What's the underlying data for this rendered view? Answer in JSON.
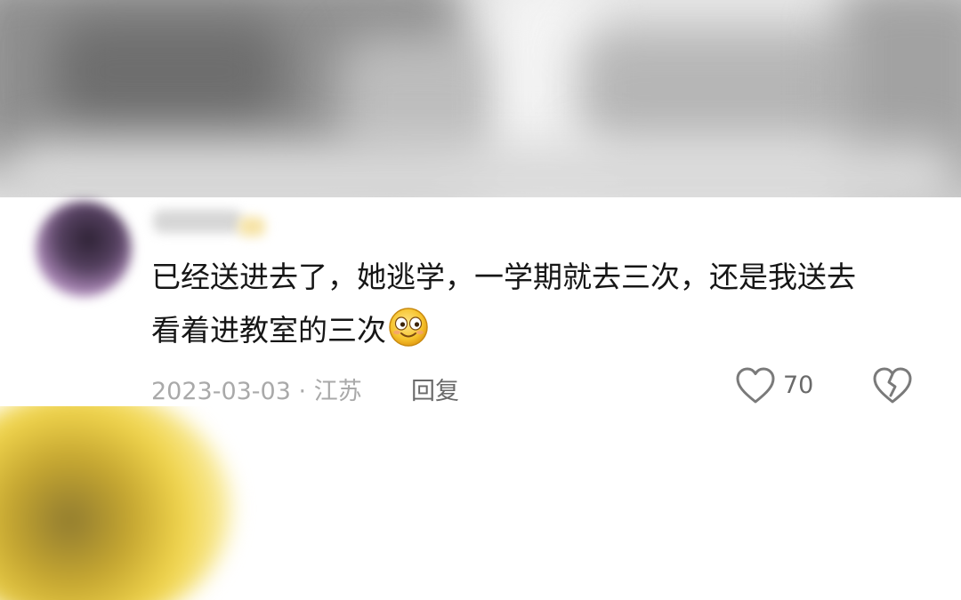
{
  "comment": {
    "text_line1": "已经送进去了，她逃学，一学期就去三次，还是我送去",
    "text_line2": "看着进教室的三次",
    "emoji": "face-emoji",
    "date": "2023-03-03",
    "separator": "·",
    "location": "江苏",
    "reply_label": "回复",
    "like_count": "70"
  },
  "icons": {
    "like": "heart-outline-icon",
    "dislike": "broken-heart-icon"
  },
  "colors": {
    "text": "#161616",
    "meta": "#a9a9a9",
    "action": "#6a6a6a",
    "icon": "#7a7a7a"
  }
}
